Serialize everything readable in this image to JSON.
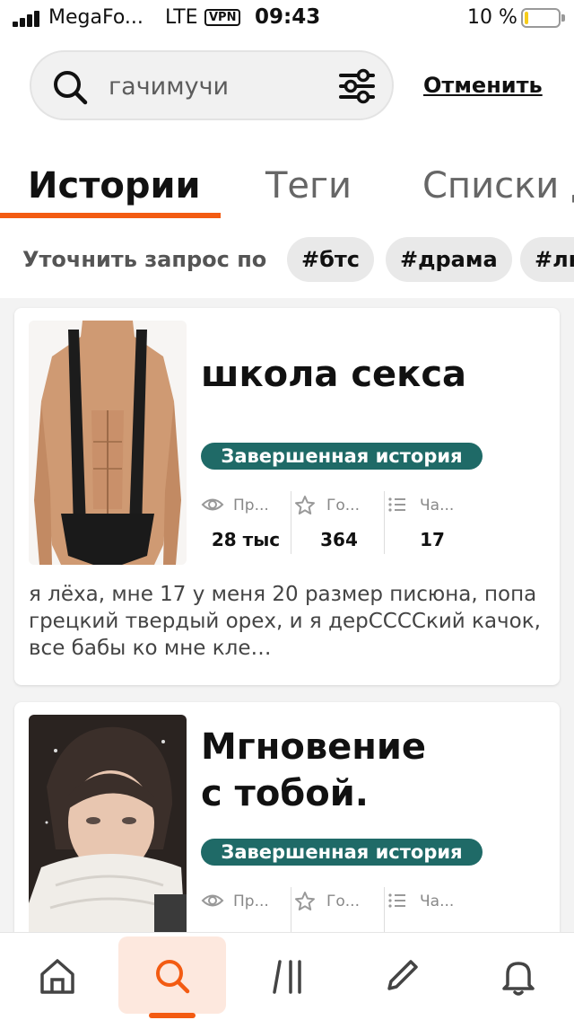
{
  "status_bar": {
    "carrier": "MegaFo...",
    "network": "LTE",
    "vpn": "VPN",
    "time": "09:43",
    "battery_text": "10 %",
    "battery_level": 0.1
  },
  "search": {
    "value": "гачимучи",
    "cancel_label": "Отменить"
  },
  "tabs": [
    {
      "label": "Истории",
      "active": true
    },
    {
      "label": "Теги",
      "active": false
    },
    {
      "label": "Списки д",
      "active": false
    }
  ],
  "refine": {
    "label": "Уточнить запрос по",
    "chips": [
      "#бтс",
      "#драма",
      "#лю"
    ]
  },
  "stories": [
    {
      "title": "школа секса",
      "status": "Завершенная история",
      "stats": {
        "views_label": "Пр...",
        "views": "28 тыс",
        "votes_label": "Го...",
        "votes": "364",
        "parts_label": "Ча...",
        "parts": "17"
      },
      "description": "я лёха, мне 17 у меня 20 размер писюна, попа грецкий твердый орех, и я дерСССCкий качок, все бабы ко мне кле…"
    },
    {
      "title_line1": "Мгновение",
      "title_line2": "с тобой.",
      "status": "Завершенная история",
      "stats": {
        "views_label": "Пр...",
        "votes_label": "Го...",
        "parts_label": "Ча..."
      }
    }
  ],
  "bottom_nav": [
    {
      "icon": "home-icon"
    },
    {
      "icon": "search-icon",
      "active": true
    },
    {
      "icon": "library-icon"
    },
    {
      "icon": "pencil-icon"
    },
    {
      "icon": "bell-icon"
    }
  ],
  "colors": {
    "accent": "#f35b12",
    "badge": "#1f6a67",
    "active_nav_bg": "#fde8de"
  }
}
